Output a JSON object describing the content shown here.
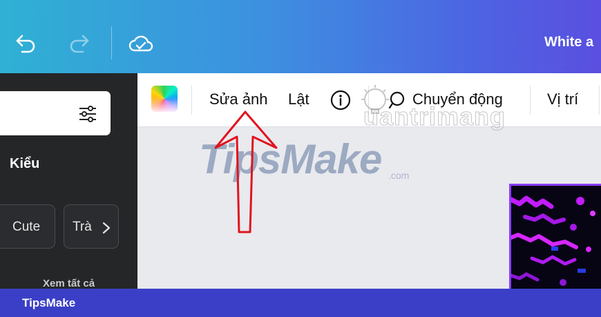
{
  "header": {
    "doc_title": "White a"
  },
  "toolbar": {
    "edit_photo": "Sửa ảnh",
    "flip": "Lật",
    "animate": "Chuyển động",
    "position": "Vị trí"
  },
  "sidebar": {
    "section_label": "Kiểu",
    "chips": [
      "Cute",
      "Trà"
    ],
    "see_all": "Xem tất cả"
  },
  "watermarks": {
    "quantrimang": "uantrimang",
    "tipsmake": "TipsMake",
    "tipsmake_suffix": ".com"
  },
  "footer": {
    "label": "TipsMake"
  },
  "colors": {
    "accent_purple": "#8b3dff",
    "footer_blue": "#3b3fc7",
    "annotation_red": "#e0141e",
    "sidebar_dark": "#252628"
  }
}
